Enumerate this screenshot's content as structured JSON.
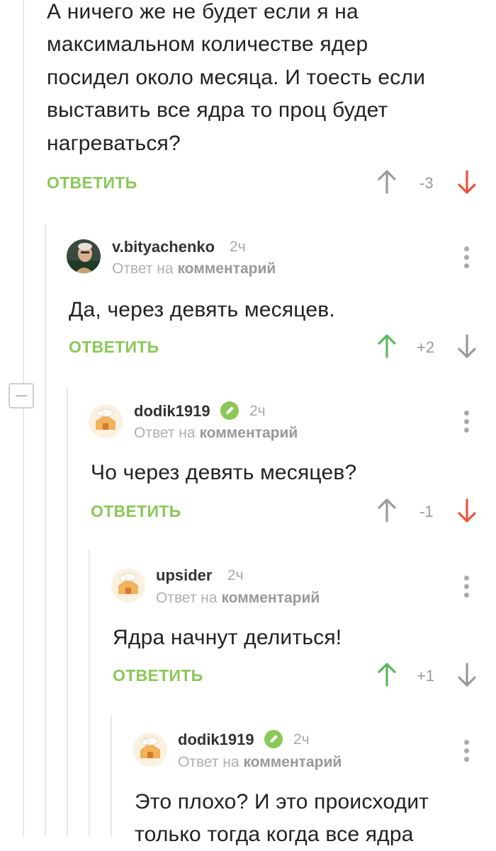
{
  "comments": [
    {
      "text_lines": [
        "А ничего же не будет если я на",
        "максимальном количестве ядер",
        "посидел около месяца. И тоесть если",
        "выставить все ядра то проц будет",
        "нагреваться?"
      ],
      "reply_label": "ОТВЕТИТЬ",
      "score": "-3",
      "vote": "down"
    },
    {
      "username": "v.bityachenko",
      "time": "2ч",
      "reply_to_prefix": "Ответ на",
      "reply_to_link": "комментарий",
      "text_lines": [
        "Да, через девять месяцев."
      ],
      "reply_label": "ОТВЕТИТЬ",
      "score": "+2",
      "vote": "up"
    },
    {
      "username": "dodik1919",
      "time": "2ч",
      "reply_to_prefix": "Ответ на",
      "reply_to_link": "комментарий",
      "text_lines": [
        "Чо через девять месяцев?"
      ],
      "reply_label": "ОТВЕТИТЬ",
      "score": "-1",
      "vote": "down"
    },
    {
      "username": "upsider",
      "time": "2ч",
      "reply_to_prefix": "Ответ на",
      "reply_to_link": "комментарий",
      "text_lines": [
        "Ядра начнут делиться!"
      ],
      "reply_label": "ОТВЕТИТЬ",
      "score": "+1",
      "vote": "up"
    },
    {
      "username": "dodik1919",
      "time": "2ч",
      "reply_to_prefix": "Ответ на",
      "reply_to_link": "комментарий",
      "text_lines": [
        "Это плохо? И это происходит",
        "только тогда когда все ядра"
      ]
    }
  ],
  "colors": {
    "reply_green": "#8ac858",
    "vote_up_active": "#5cb85c",
    "vote_down_active": "#e8533f",
    "vote_inactive": "#9a9a9a",
    "thread_line": "#e8e8e8"
  },
  "icons": {
    "upvote": "arrow-up-icon",
    "downvote": "arrow-down-icon",
    "menu": "kebab-menu-icon",
    "badge": "pencil-badge-icon",
    "collapse": "collapse-minus-icon"
  }
}
